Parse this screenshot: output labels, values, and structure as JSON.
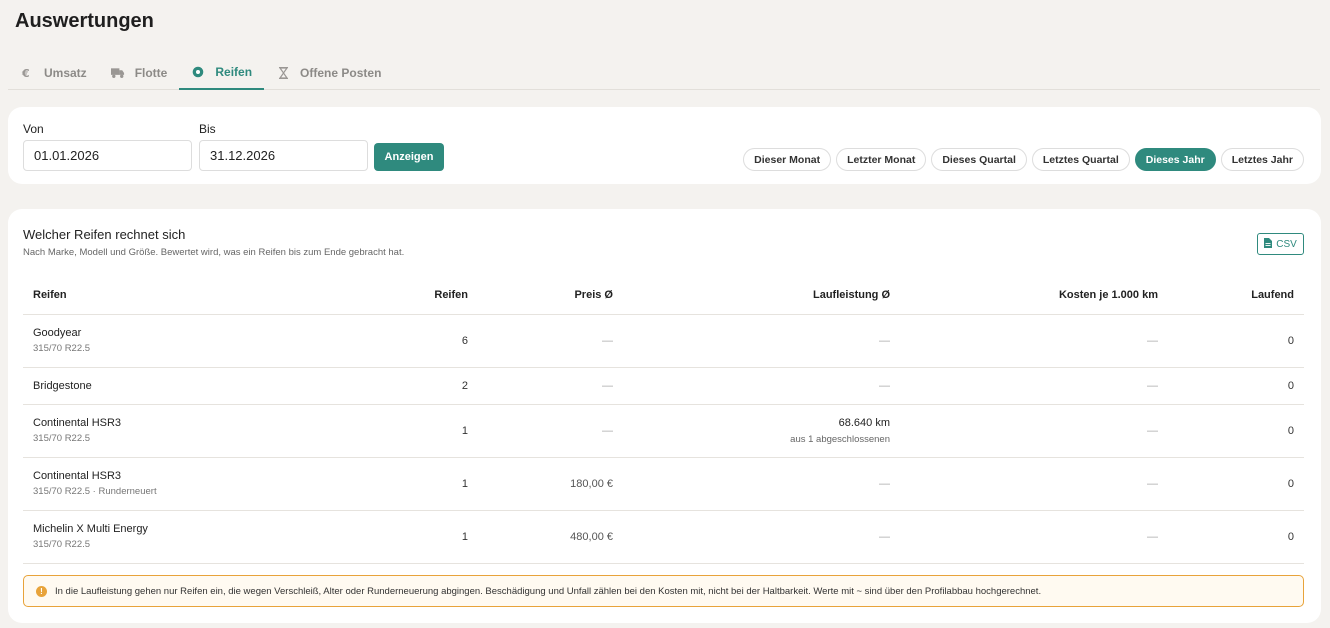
{
  "page": {
    "title": "Auswertungen"
  },
  "tabs": [
    {
      "label": "Umsatz",
      "icon": "euro-icon",
      "active": false
    },
    {
      "label": "Flotte",
      "icon": "truck-icon",
      "active": false
    },
    {
      "label": "Reifen",
      "icon": "tire-icon",
      "active": true
    },
    {
      "label": "Offene Posten",
      "icon": "hourglass-icon",
      "active": false
    }
  ],
  "filter": {
    "from_label": "Von",
    "from_value": "01.01.2026",
    "to_label": "Bis",
    "to_value": "31.12.2026",
    "show_label": "Anzeigen",
    "presets": [
      {
        "label": "Dieser Monat",
        "active": false
      },
      {
        "label": "Letzter Monat",
        "active": false
      },
      {
        "label": "Dieses Quartal",
        "active": false
      },
      {
        "label": "Letztes Quartal",
        "active": false
      },
      {
        "label": "Dieses Jahr",
        "active": true
      },
      {
        "label": "Letztes Jahr",
        "active": false
      }
    ]
  },
  "report": {
    "title": "Welcher Reifen rechnet sich",
    "subtitle": "Nach Marke, Modell und Größe. Bewertet wird, was ein Reifen bis zum Ende gebracht hat.",
    "csv_label": "CSV",
    "columns": [
      "Reifen",
      "Reifen",
      "Preis Ø",
      "Laufleistung Ø",
      "Kosten je 1.000 km",
      "Laufend"
    ],
    "rows": [
      {
        "name": "Goodyear",
        "size": "315/70 R22.5",
        "count": "6",
        "price": "—",
        "mileage": "—",
        "mileage_sub": "",
        "cost": "—",
        "running": "0"
      },
      {
        "name": "Bridgestone",
        "size": "",
        "count": "2",
        "price": "—",
        "mileage": "—",
        "mileage_sub": "",
        "cost": "—",
        "running": "0"
      },
      {
        "name": "Continental HSR3",
        "size": "315/70 R22.5",
        "count": "1",
        "price": "—",
        "mileage": "68.640 km",
        "mileage_sub": "aus 1 abgeschlossenen",
        "cost": "—",
        "running": "0"
      },
      {
        "name": "Continental HSR3",
        "size": "315/70 R22.5 · Runderneuert",
        "count": "1",
        "price": "180,00 €",
        "mileage": "—",
        "mileage_sub": "",
        "cost": "—",
        "running": "0"
      },
      {
        "name": "Michelin X Multi Energy",
        "size": "315/70 R22.5",
        "count": "1",
        "price": "480,00 €",
        "mileage": "—",
        "mileage_sub": "",
        "cost": "—",
        "running": "0"
      }
    ],
    "note": "In die Laufleistung gehen nur Reifen ein, die wegen Verschleiß, Alter oder Runderneuerung abgingen. Beschädigung und Unfall zählen bei den Kosten mit, nicht bei der Haltbarkeit. Werte mit ~ sind über den Profilabbau hochgerechnet."
  },
  "colors": {
    "accent": "#2f8a7e",
    "warning": "#e8a33a",
    "background": "#f4f2ef"
  }
}
